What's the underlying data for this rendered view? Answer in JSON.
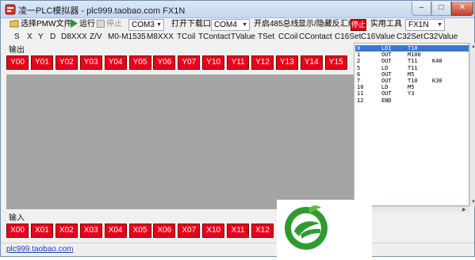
{
  "title": "凌一PLC模拟器 - plc999.taobao.com  FX1N",
  "toolbar": {
    "select_pmw": "选择PMW文件",
    "run": "运行",
    "stop": "停止",
    "com_port_1": "COM3",
    "open_download": "打开下载口",
    "com_port_2": "COM4",
    "open_485": "开启485总线",
    "toggle_disasm": "显示/隐藏反汇编",
    "stop_red": "停止",
    "tools": "实用工具",
    "plc_model": "FX1N"
  },
  "registers": [
    "S",
    "X",
    "Y",
    "D",
    "D8XXX",
    "Z/V",
    "M0-M1535",
    "M8XXX",
    "TCoil",
    "TContact",
    "TValue",
    "TSet",
    "CCoil",
    "CContact",
    "C16Set",
    "C16Value",
    "C32Set",
    "C32Value"
  ],
  "output_label": "输出",
  "outputs": [
    "Y00",
    "Y01",
    "Y02",
    "Y03",
    "Y04",
    "Y05",
    "Y06",
    "Y07",
    "Y10",
    "Y11",
    "Y12",
    "Y13",
    "Y14",
    "Y15"
  ],
  "input_label": "输入",
  "inputs": [
    "X00",
    "X01",
    "X02",
    "X03",
    "X04",
    "X05",
    "X06",
    "X07",
    "X10",
    "X11",
    "X12"
  ],
  "code": [
    {
      "num": "0",
      "op": "LDI",
      "a1": "T10",
      "a2": "",
      "selected": true
    },
    {
      "num": "1",
      "op": "OUT",
      "a1": "M100",
      "a2": ""
    },
    {
      "num": "2",
      "op": "OUT",
      "a1": "T11",
      "a2": "K40"
    },
    {
      "num": "5",
      "op": "LD",
      "a1": "T11",
      "a2": ""
    },
    {
      "num": "6",
      "op": "OUT",
      "a1": "M5",
      "a2": ""
    },
    {
      "num": "7",
      "op": "OUT",
      "a1": "T10",
      "a2": "K30"
    },
    {
      "num": "10",
      "op": "LD",
      "a1": "M5",
      "a2": ""
    },
    {
      "num": "11",
      "op": "OUT",
      "a1": "Y3",
      "a2": ""
    },
    {
      "num": "12",
      "op": "END",
      "a1": "",
      "a2": ""
    }
  ],
  "status_link": "plc999.taobao.com",
  "colors": {
    "io_active": "#e8001c",
    "stop_button": "#e0001a",
    "selection": "#3a75d2",
    "logo_green": "#2f9b2f"
  },
  "icons": {
    "app": "plc-app-icon",
    "folder": "folder-icon",
    "run": "play-icon",
    "stop": "stop-icon",
    "logo": "leaf-logo-icon"
  }
}
